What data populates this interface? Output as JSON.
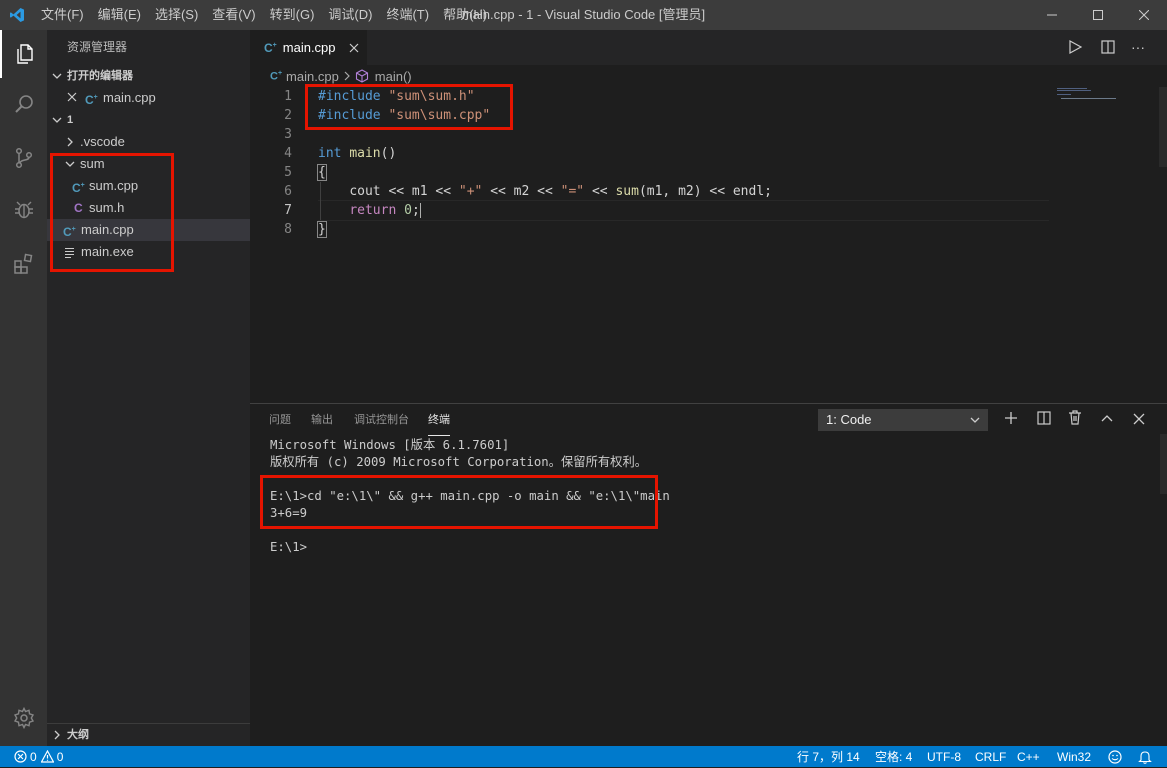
{
  "titlebar": {
    "menus": [
      "文件(F)",
      "编辑(E)",
      "选择(S)",
      "查看(V)",
      "转到(G)",
      "调试(D)",
      "终端(T)",
      "帮助(H)"
    ],
    "window_title": "main.cpp - 1 - Visual Studio Code [管理员]"
  },
  "sidebar": {
    "title": "资源管理器",
    "open_editors_label": "打开的编辑器",
    "open_editor_file": "main.cpp",
    "folder_label": "1",
    "items": [
      {
        "label": ".vscode",
        "kind": "folder-collapsed"
      },
      {
        "label": "sum",
        "kind": "folder-expanded"
      },
      {
        "label": "sum.cpp",
        "kind": "cpp"
      },
      {
        "label": "sum.h",
        "kind": "c"
      },
      {
        "label": "main.cpp",
        "kind": "cpp"
      },
      {
        "label": "main.exe",
        "kind": "file"
      }
    ],
    "outline_label": "大纲"
  },
  "editor": {
    "tab_label": "main.cpp",
    "breadcrumb": {
      "file": "main.cpp",
      "symbol": "main()"
    },
    "line_numbers": [
      "1",
      "2",
      "3",
      "4",
      "5",
      "6",
      "7",
      "8"
    ],
    "lines": {
      "l1": {
        "directive": "#include",
        "str": "\"sum\\sum.h\""
      },
      "l2": {
        "directive": "#include",
        "str": "\"sum\\sum.cpp\""
      },
      "l4": {
        "type": "int",
        "name": "main",
        "parens": "()"
      },
      "l5": {
        "brace": "{"
      },
      "l6": {
        "a": "cout << m1 << ",
        "s1": "\"+\"",
        "b": " << m2 << ",
        "s2": "\"=\"",
        "c": " << ",
        "fn": "sum",
        "d": "(m1, m2) << endl;"
      },
      "l7": {
        "kw": "return",
        "num": "0",
        "end": ";"
      },
      "l8": {
        "brace": "}"
      }
    }
  },
  "panel": {
    "tabs": [
      "问题",
      "输出",
      "调试控制台",
      "终端"
    ],
    "active_tab": "终端",
    "terminal_select": "1: Code",
    "terminal_lines": [
      "Microsoft Windows [版本 6.1.7601]",
      "版权所有 (c) 2009 Microsoft Corporation。保留所有权利。",
      "E:\\1>cd \"e:\\1\\\" && g++ main.cpp -o main && \"e:\\1\\\"main",
      "3+6=9",
      "E:\\1>"
    ]
  },
  "statusbar": {
    "errors": "0",
    "warnings": "0",
    "position": "行 7，列 14",
    "spaces": "空格: 4",
    "encoding": "UTF-8",
    "eol": "CRLF",
    "language": "C++",
    "platform": "Win32"
  },
  "colors": {
    "accent": "#007acc",
    "highlight_box": "#e51400",
    "cpp_icon": "#519aba",
    "c_icon": "#a074c4"
  }
}
